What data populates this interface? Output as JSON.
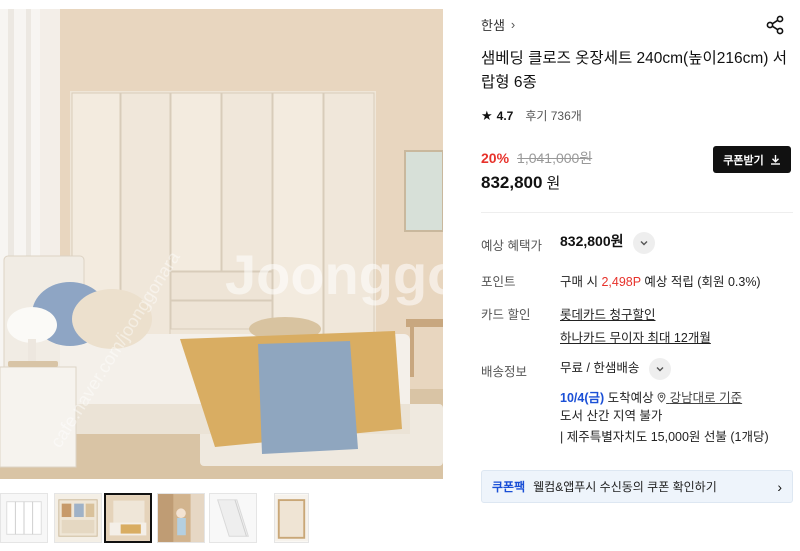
{
  "brand": {
    "name": "한샘",
    "chevron": "›"
  },
  "product": {
    "title": "샘베딩 클로즈 옷장세트 240cm(높이216cm) 서랍형 6종",
    "rating": "4.7",
    "reviews": "후기 736개"
  },
  "price": {
    "discount": "20%",
    "original": "1,041,000원",
    "sale": "832,800",
    "currency": "원",
    "coupon_button": "쿠폰받기"
  },
  "benefits": {
    "label": "예상 혜택가",
    "value": "832,800원"
  },
  "points": {
    "label": "포인트",
    "prefix": "구매 시",
    "amount": "2,498P",
    "suffix": "예상 적립 (회원 0.3%)"
  },
  "card": {
    "label": "카드 할인",
    "line1": "롯데카드 청구할인",
    "line2": "하나카드 무이자 최대 12개월"
  },
  "delivery": {
    "label": "배송정보",
    "method": "무료 / 한샘배송",
    "date": "10/4(금)",
    "date_suffix": "도착예상",
    "location": "강남대로 기준",
    "note": "도서 산간 지역 불가",
    "jeju": "| 제주특별자치도 15,000원 선불 (1개당)"
  },
  "promo": {
    "tag": "쿠폰팩",
    "text": "웰컴&앱푸시 수신동의 쿠폰 확인하기"
  },
  "watermark": {
    "main": "Joonggo",
    "url": "cafe.naver.com/joonggonara"
  },
  "colors": {
    "accent_red": "#e7322b",
    "accent_blue": "#1a4fd6",
    "button_dark": "#111111"
  },
  "icons": [
    "chevron-right-icon",
    "share-icon",
    "star-icon",
    "download-icon",
    "chevron-down-icon",
    "location-pin-icon"
  ]
}
